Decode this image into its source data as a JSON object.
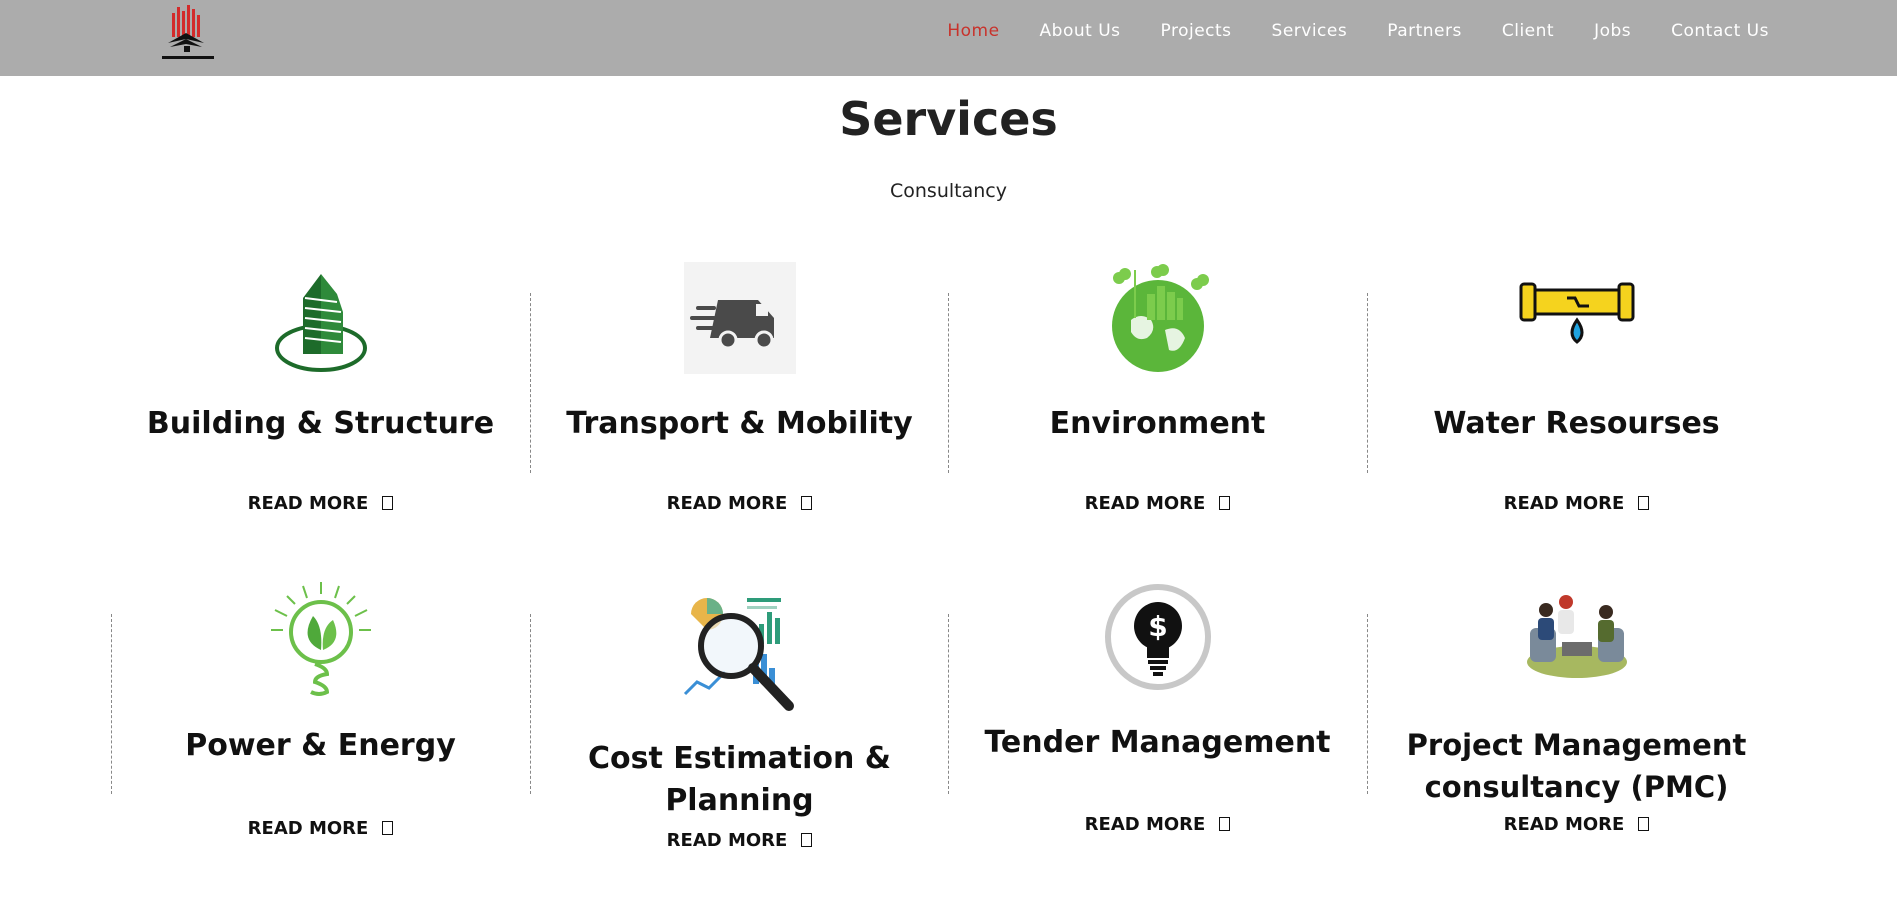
{
  "nav": {
    "logo_alt": "DCON CORPORATION",
    "items": [
      "Home",
      "About Us",
      "Projects",
      "Services",
      "Partners",
      "Client",
      "Jobs",
      "Contact Us"
    ],
    "active_index": 0
  },
  "page": {
    "title": "Services",
    "subtitle": "Consultancy",
    "read_more": "READ MORE"
  },
  "services": [
    {
      "title": "Building & Structure",
      "icon": "building-icon"
    },
    {
      "title": "Transport & Mobility",
      "icon": "truck-icon"
    },
    {
      "title": "Environment",
      "icon": "green-earth-icon"
    },
    {
      "title": "Water Resourses",
      "icon": "leaking-pipe-icon"
    },
    {
      "title": "Power & Energy",
      "icon": "eco-bulb-icon"
    },
    {
      "title": "Cost Estimation & Planning",
      "icon": "magnifier-chart-icon"
    },
    {
      "title": "Tender Management",
      "icon": "dollar-bulb-icon"
    },
    {
      "title": "Project Management consultancy (PMC)",
      "icon": "meeting-icon"
    }
  ],
  "colors": {
    "nav_bg": "#acacac",
    "active_link": "#c8322b",
    "building_green": "#1d6b2a",
    "leaf_green": "#6cc04a",
    "pipe_yellow": "#f5d31e"
  }
}
